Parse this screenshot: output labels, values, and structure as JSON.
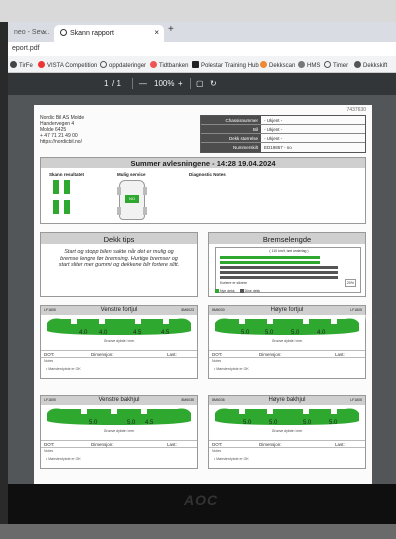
{
  "browser": {
    "tabs": [
      {
        "label": "neo - Sev..."
      },
      {
        "label": "Skann rapport"
      }
    ],
    "url": "eport.pdf",
    "bookmarks": [
      {
        "label": "TirFe"
      },
      {
        "label": "VISTA Competition"
      },
      {
        "label": "oppdateringer"
      },
      {
        "label": "Tidtbanken"
      },
      {
        "label": "Polestar Training Hub"
      },
      {
        "label": "Dekkscan"
      },
      {
        "label": "HMS"
      },
      {
        "label": "Timer"
      },
      {
        "label": "Dekkskift"
      }
    ]
  },
  "pdf_toolbar": {
    "page": "1",
    "of": "/ 1",
    "zoom": "100%"
  },
  "report": {
    "corner_id": "7437630",
    "company": "Nordic Bil AS Molde\nHandervegen 4\nMolde 6425\n+ 47 71 21 49 00\nhttps://nordicbil.no/",
    "info": [
      {
        "key": "Chassisnummer",
        "value": "- Ukjent -"
      },
      {
        "key": "Bil",
        "value": "- Ukjent -"
      },
      {
        "key": "Dekk størrelse",
        "value": "- Ukjent -"
      },
      {
        "key": "Nummerskilt",
        "value": "ED19857 - no"
      }
    ],
    "summary_title": "Summer avlesningene - 14:28 19.04.2024",
    "summary_cols": {
      "scan": "Skann resultatet",
      "service": "Mulig service",
      "notes": "Diagnostic Notes"
    },
    "car_badge": "NO",
    "tips_title": "Dekk tips",
    "tips_text": "Start og stopp bilen sakte når det er mulig og bremse lengre før bremsing. Hurtige bremser og start sliter mer gummi og dekkene blir fortere slitt.",
    "brake_title": "Bremselengde",
    "brake_sub": "( 110 km/t, tørt underlag )",
    "brake_label": "Kortere er sikrere",
    "brake_pct": "20%",
    "legend_new": "Nye dekk",
    "legend_yours": "Dine dekk",
    "tyres": [
      {
        "title": "Venstre fortjul",
        "left_code": "LF1805",
        "right_code": "8M6023",
        "depths": [
          "4.0",
          "4.0",
          "4.5",
          "4.5"
        ],
        "dot": "DOT:",
        "dim": "Dimensjon:",
        "load": "Last:",
        "notes": "Notes",
        "note_line": "Mønsterdybde er OK"
      },
      {
        "title": "Høyre fortjul",
        "left_code": "8M6030",
        "right_code": "LF1805",
        "depths": [
          "5.0",
          "5.0",
          "5.0",
          "4.0"
        ],
        "dot": "DOT:",
        "dim": "Dimensjon:",
        "load": "Last:",
        "notes": "Notes",
        "note_line": "Mønsterdybde er OK"
      },
      {
        "title": "Venstre bakhjul",
        "left_code": "LF1805",
        "right_code": "8M6035",
        "depths": [
          "5.0",
          "5.0",
          "4.5"
        ],
        "dot": "DOT:",
        "dim": "Dimensjon:",
        "load": "Last:",
        "notes": "Notes",
        "note_line": "Mønsterdybde er OK"
      },
      {
        "title": "Høyre bakhjul",
        "left_code": "8M6036",
        "right_code": "LF1805",
        "depths": [
          "5.0",
          "5.0",
          "5.0",
          "5.0"
        ],
        "dot": "DOT:",
        "dim": "Dimensjon:",
        "load": "Last:",
        "notes": "Notes",
        "note_line": "Mønsterdybde er OK"
      }
    ],
    "tread_label": "Groove dybde i mm"
  },
  "monitor_brand": "AOC",
  "colors": {
    "accent_green": "#2ea82e",
    "header_gray": "#cfcfcf",
    "pdf_toolbar": "#323639"
  }
}
